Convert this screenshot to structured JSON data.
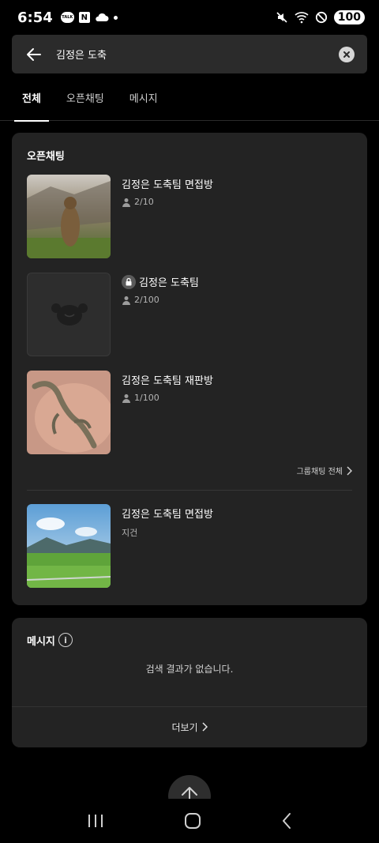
{
  "status_bar": {
    "time": "6:54",
    "talk_badge": "TALK",
    "n_badge": "N",
    "battery": "100"
  },
  "search": {
    "query": "김정은 도축"
  },
  "tabs": [
    {
      "label": "전체",
      "active": true
    },
    {
      "label": "오픈채팅",
      "active": false
    },
    {
      "label": "메시지",
      "active": false
    }
  ],
  "open_chat": {
    "title": "오픈채팅",
    "rooms": [
      {
        "name": "김정은 도축팀 면접방",
        "members": "2/10",
        "locked": false,
        "thumb": "marmot-photo"
      },
      {
        "name": "김정은 도축팀",
        "members": "2/100",
        "locked": true,
        "thumb": "default-profile"
      },
      {
        "name": "김정은 도축팀 재판방",
        "members": "1/100",
        "locked": false,
        "thumb": "lizard-photo"
      }
    ],
    "group_more_label": "그룹채팅 전체",
    "extra_room": {
      "name": "김정은 도축팀 면접방",
      "sub": "지건",
      "thumb": "landscape-photo"
    }
  },
  "messages": {
    "title": "메시지",
    "empty_text": "검색 결과가 없습니다.",
    "see_more_label": "더보기"
  },
  "colors": {
    "background": "#000000",
    "card": "#232323",
    "search_bar": "#2b2b2b"
  }
}
